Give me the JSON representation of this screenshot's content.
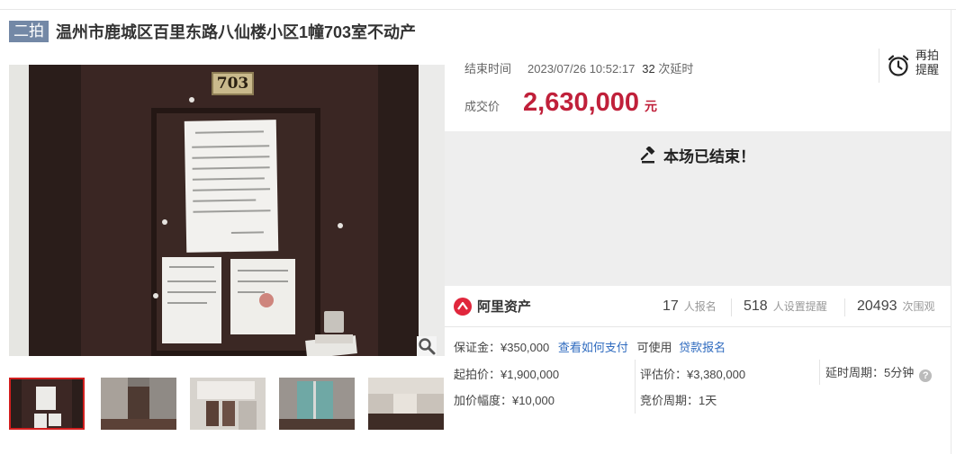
{
  "header": {
    "tag": "二拍",
    "title": "温州市鹿城区百里东路八仙楼小区1幢703室不动产"
  },
  "gallery": {
    "door_number": "703",
    "zoom_icon": "magnifier-icon",
    "thumbnails": [
      "门牌公告",
      "客厅",
      "厨房",
      "阳台",
      "卧室"
    ],
    "active_index": 0
  },
  "auction": {
    "end_label": "结束时间",
    "end_time": "2023/07/26 10:52:17",
    "delay_count": "32",
    "delay_label": "次延时",
    "deal_label": "成交价",
    "deal_price": "2,630,000",
    "deal_unit": "元",
    "remind_line1": "再拍",
    "remind_line2": "提醒",
    "remind_icon": "alarm-clock-icon",
    "ended_text": "本场已结束！",
    "ended_icon": "gavel-icon"
  },
  "stats": {
    "platform": "阿里资产",
    "signup_count": "17",
    "signup_label": "人报名",
    "remind_count": "518",
    "remind_label": "人设置提醒",
    "watch_count": "20493",
    "watch_label": "次围观"
  },
  "details": {
    "deposit": "保证金：¥350,000",
    "how_to_pay": "查看如何支付",
    "can_use": "可使用",
    "loan_signup": "贷款报名",
    "start_price": "起拍价：¥1,900,000",
    "assess_price": "评估价：¥3,380,000",
    "delay_period": "延时周期：5分钟",
    "increment": "加价幅度：¥10,000",
    "bid_period": "竞价周期：1天"
  },
  "colors": {
    "accent_red": "#c0203a",
    "tag_bg": "#7388a6",
    "link": "#2f6bbf"
  }
}
